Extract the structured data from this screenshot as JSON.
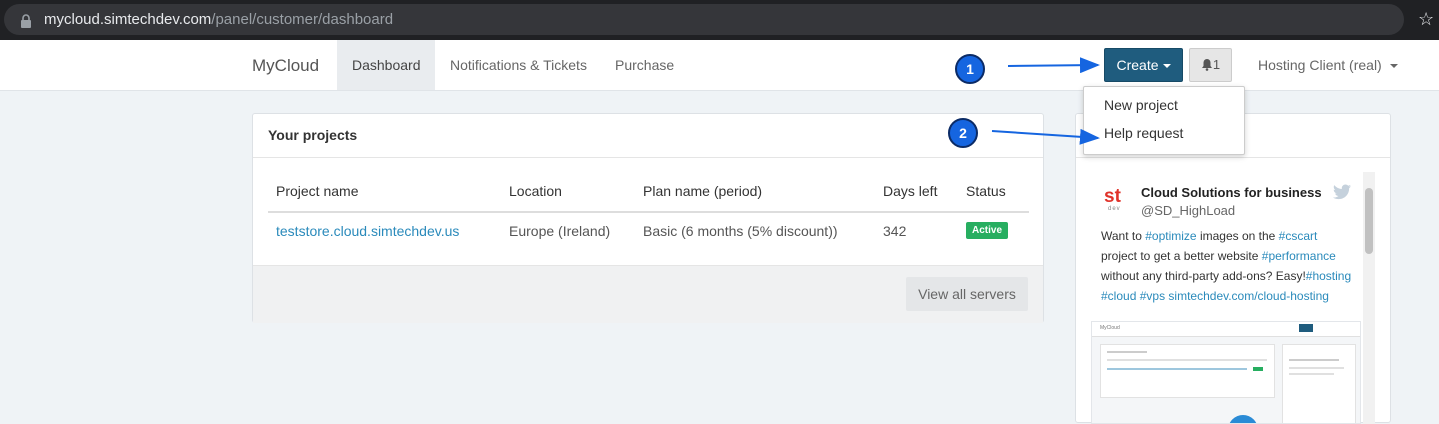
{
  "browser": {
    "url_host": "mycloud.simtechdev.com",
    "url_path": "/panel/customer/dashboard",
    "bookmark_icon": "star-icon"
  },
  "navbar": {
    "brand": "MyCloud",
    "items": [
      {
        "label": "Dashboard",
        "active": true
      },
      {
        "label": "Notifications & Tickets",
        "active": false
      },
      {
        "label": "Purchase",
        "active": false
      }
    ],
    "create_label": "Create",
    "bell_count": "1",
    "user_label": "Hosting Client (real)"
  },
  "dropdown": {
    "items": [
      "New project",
      "Help request"
    ]
  },
  "projects": {
    "title": "Your projects",
    "columns": [
      "Project name",
      "Location",
      "Plan name (period)",
      "Days left",
      "Status"
    ],
    "rows": [
      {
        "name": "teststore.cloud.simtechdev.us",
        "location": "Europe (Ireland)",
        "plan": "Basic (6 months (5% discount))",
        "days_left": "342",
        "status": "Active"
      }
    ],
    "view_all_label": "View all servers"
  },
  "tweet": {
    "logo_text": "st",
    "logo_sub": "dev",
    "name": "Cloud Solutions for business",
    "handle": "@SD_HighLoad",
    "text": [
      {
        "t": "Want to ",
        "tag": false
      },
      {
        "t": "#optimize",
        "tag": true
      },
      {
        "t": " images on the ",
        "tag": false
      },
      {
        "t": "#cscart",
        "tag": true
      },
      {
        "t": " project to get a better website ",
        "tag": false
      },
      {
        "t": "#performance",
        "tag": true
      },
      {
        "t": " without any third-party add-ons? Easy!",
        "tag": false
      },
      {
        "t": "#hosting",
        "tag": true
      },
      {
        "t": " ",
        "tag": false
      },
      {
        "t": "#cloud",
        "tag": true
      },
      {
        "t": " ",
        "tag": false
      },
      {
        "t": "#vps",
        "tag": true
      },
      {
        "t": " ",
        "tag": false
      },
      {
        "t": "simtechdev.com/cloud-hosting",
        "tag": true
      }
    ]
  },
  "annotations": {
    "marker1": "1",
    "marker2": "2"
  },
  "colors": {
    "primary_button": "#1f5c7e",
    "link": "#2a8abb",
    "active_badge": "#27ae60",
    "annotation_marker": "#1565e0"
  }
}
